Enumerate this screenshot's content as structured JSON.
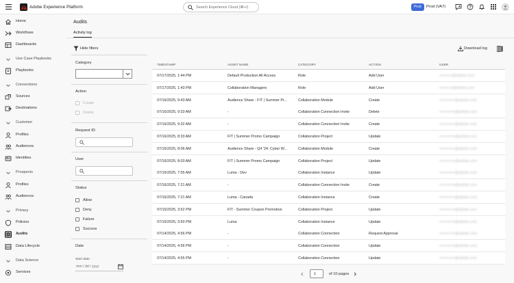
{
  "app": {
    "title": "Adobe Experience Platform",
    "search_placeholder": "Search Experience Cloud (⌘+/)",
    "env_badge": "Prod",
    "sandbox": "Prod (VA7)"
  },
  "sidebar": {
    "items": [
      {
        "label": "Home",
        "icon": "home-icon"
      },
      {
        "label": "Workflows",
        "icon": "workflows-icon"
      },
      {
        "label": "Dashboards",
        "icon": "dashboards-icon"
      },
      {
        "label": "Use Case Playbooks",
        "icon": "chevron-down-icon"
      },
      {
        "label": "Playbooks",
        "icon": "playbooks-icon"
      },
      {
        "label": "Connections",
        "icon": "chevron-down-icon"
      },
      {
        "label": "Sources",
        "icon": "sources-icon"
      },
      {
        "label": "Destinations",
        "icon": "destinations-icon"
      },
      {
        "label": "Customer",
        "icon": "chevron-down-icon"
      },
      {
        "label": "Profiles",
        "icon": "profiles-icon"
      },
      {
        "label": "Audiences",
        "icon": "audiences-icon"
      },
      {
        "label": "Identities",
        "icon": "identities-icon"
      },
      {
        "label": "Prospects",
        "icon": "chevron-down-icon"
      },
      {
        "label": "Profiles",
        "icon": "profiles-icon"
      },
      {
        "label": "Audiences",
        "icon": "audiences-icon"
      },
      {
        "label": "Privacy",
        "icon": "chevron-down-icon"
      },
      {
        "label": "Policies",
        "icon": "policies-icon"
      },
      {
        "label": "Audits",
        "icon": "audits-icon"
      },
      {
        "label": "Data Lifecycle",
        "icon": "data-lifecycle-icon"
      },
      {
        "label": "Data Science",
        "icon": "chevron-down-icon"
      },
      {
        "label": "Services",
        "icon": "services-icon"
      }
    ]
  },
  "page": {
    "title": "Audits",
    "tab": "Activity log"
  },
  "toolbar": {
    "hide_filters": "Hide filters",
    "download_log": "Download log"
  },
  "filters": {
    "category": {
      "label": "Category",
      "value": ""
    },
    "action": {
      "label": "Action",
      "options": [
        "Create",
        "Delete"
      ]
    },
    "request_id": {
      "label": "Request ID",
      "value": ""
    },
    "user": {
      "label": "User",
      "value": ""
    },
    "status": {
      "label": "Status",
      "options": [
        "Allow",
        "Deny",
        "Failure",
        "Success"
      ]
    },
    "date": {
      "label": "Date",
      "start_label": "Start date",
      "placeholder": "mm / dd / yyyy"
    }
  },
  "table": {
    "headers": [
      "TIMESTAMP",
      "ASSET NAME",
      "CATEGORY",
      "ACTION",
      "USER"
    ],
    "rows": [
      {
        "timestamp": "07/17/2025, 1:44 PM",
        "asset": "Default Production All Access",
        "category": "Role",
        "action": "Add User",
        "user": "••••••••••@adobe.com"
      },
      {
        "timestamp": "07/17/2025, 1:43 PM",
        "asset": "Collaboration Managers",
        "category": "Role",
        "action": "Add User",
        "user": "••••••••••@adobe.com"
      },
      {
        "timestamp": "07/16/2025, 9:43 AM",
        "asset": "Audience Share - FIT | Summer Pr...",
        "category": "Collaboration Module",
        "action": "Create",
        "user": "••••••••••••@adobe.com"
      },
      {
        "timestamp": "07/16/2025, 9:33 AM",
        "asset": "-",
        "category": "Collaboration Connection Invite",
        "action": "Delete",
        "user": "••••••••••••@adobe.com"
      },
      {
        "timestamp": "07/16/2025, 9:32 AM",
        "asset": "-",
        "category": "Collaboration Connection Invite",
        "action": "Create",
        "user": "••••••••••••@adobe.com"
      },
      {
        "timestamp": "07/16/2025, 8:33 AM",
        "asset": "FIT | Summer Promo Campaign",
        "category": "Collaboration Project",
        "action": "Update",
        "user": "••••••••••••@adobe.com"
      },
      {
        "timestamp": "07/16/2025, 8:06 AM",
        "asset": "Audience Share - Q4 '24: Cyber W...",
        "category": "Collaboration Module",
        "action": "Create",
        "user": "••••••••••••@adobe.com"
      },
      {
        "timestamp": "07/16/2025, 8:03 AM",
        "asset": "FIT | Summer Promo Campaign",
        "category": "Collaboration Project",
        "action": "Update",
        "user": "••••••••••••@adobe.com"
      },
      {
        "timestamp": "07/16/2025, 7:55 AM",
        "asset": "Luma - Dev",
        "category": "Collaboration Instance",
        "action": "Update",
        "user": "••••••••••••@adobe.com"
      },
      {
        "timestamp": "07/16/2025, 7:21 AM",
        "asset": "-",
        "category": "Collaboration Connection Invite",
        "action": "Create",
        "user": "••••••••••••@adobe.com"
      },
      {
        "timestamp": "07/16/2025, 7:21 AM",
        "asset": "Luma - Canada",
        "category": "Collaboration Instance",
        "action": "Create",
        "user": "••••••••••••@adobe.com"
      },
      {
        "timestamp": "07/15/2025, 3:52 PM",
        "asset": "FIT - Summer Coupon Promotion",
        "category": "Collaboration Project",
        "action": "Update",
        "user": "••••••••••••@adobe.com"
      },
      {
        "timestamp": "07/15/2025, 3:50 PM",
        "asset": "Luma",
        "category": "Collaboration Instance",
        "action": "Update",
        "user": "••••••••••••@adobe.com"
      },
      {
        "timestamp": "07/14/2025, 4:56 PM",
        "asset": "-",
        "category": "Collaboration Connection",
        "action": "Request Approval",
        "user": "••••••••••••@adobe.com"
      },
      {
        "timestamp": "07/14/2025, 4:56 PM",
        "asset": "-",
        "category": "Collaboration Connection",
        "action": "Update",
        "user": "••••••••••••@adobe.com"
      },
      {
        "timestamp": "07/14/2025, 4:55 PM",
        "asset": "-",
        "category": "Collaboration Connection",
        "action": "Update",
        "user": "••••••••••••@adobe.com"
      }
    ]
  },
  "pagination": {
    "current_page": "1",
    "of_text": "of 10 pages"
  }
}
